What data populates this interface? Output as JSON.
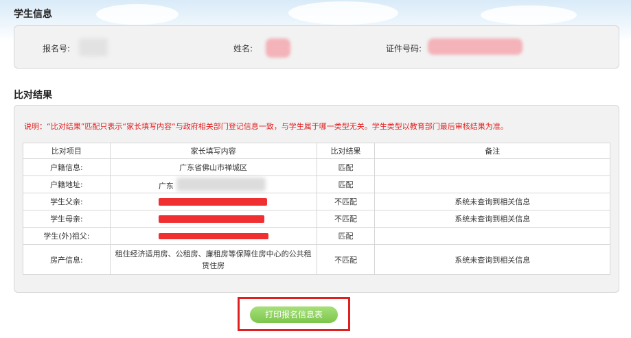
{
  "student_info": {
    "title": "学生信息",
    "reg_no_label": "报名号:",
    "name_label": "姓名:",
    "id_label": "证件号码:"
  },
  "compare": {
    "title": "比对结果",
    "note": "说明：“比对结果”匹配只表示“家长填写内容“与政府相关部门登记信息一致，与学生属于哪一类型无关。学生类型以教育部门最后审核结果为准。",
    "headers": [
      "比对项目",
      "家长填写内容",
      "比对结果",
      "备注"
    ],
    "rows": [
      {
        "item": "户籍信息:",
        "content": "广东省佛山市禅城区",
        "result": "匹配",
        "remark": ""
      },
      {
        "item": "户籍地址:",
        "content": "广东",
        "result": "匹配",
        "remark": ""
      },
      {
        "item": "学生父亲:",
        "content": "",
        "result": "不匹配",
        "remark": "系统未查询到相关信息"
      },
      {
        "item": "学生母亲:",
        "content": "",
        "result": "不匹配",
        "remark": "系统未查询到相关信息"
      },
      {
        "item": "学生(外)祖父:",
        "content": "",
        "result": "匹配",
        "remark": ""
      },
      {
        "item": "房产信息:",
        "content": "租住经济适用房、公租房、廉租房等保障住房中心的公共租赁住房",
        "result": "不匹配",
        "remark": "系统未查询到相关信息"
      }
    ]
  },
  "actions": {
    "print_label": "打印报名信息表"
  },
  "colors": {
    "match": "#1a8f1a",
    "mismatch": "#e02020",
    "button": "#8ccf5c",
    "highlight_border": "#e02020"
  }
}
